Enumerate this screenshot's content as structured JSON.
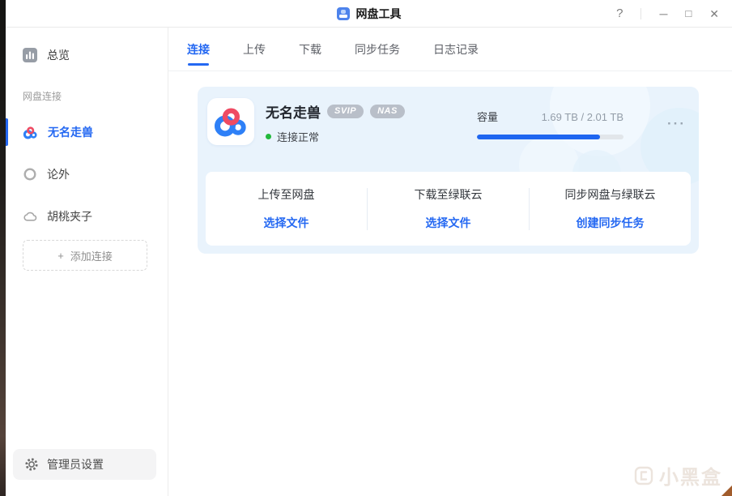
{
  "window": {
    "title": "网盘工具",
    "controls": {
      "help": "?",
      "minimize": "─",
      "maximize": "□",
      "close": "✕"
    }
  },
  "sidebar": {
    "overview_label": "总览",
    "section_label": "网盘连接",
    "connections": [
      {
        "label": "无名走兽",
        "active": true
      },
      {
        "label": "论外",
        "active": false
      },
      {
        "label": "胡桃夹子",
        "active": false
      }
    ],
    "add_icon": "+",
    "add_connection_label": "添加连接",
    "admin_settings_label": "管理员设置"
  },
  "tabs": [
    {
      "label": "连接",
      "active": true
    },
    {
      "label": "上传",
      "active": false
    },
    {
      "label": "下载",
      "active": false
    },
    {
      "label": "同步任务",
      "active": false
    },
    {
      "label": "日志记录",
      "active": false
    }
  ],
  "connection_card": {
    "name": "无名走兽",
    "badges": [
      "SVIP",
      "NAS"
    ],
    "status_text": "连接正常",
    "capacity": {
      "label": "容量",
      "used": "1.69 TB",
      "total": "2.01 TB",
      "display": "1.69 TB / 2.01 TB",
      "percent": 84
    },
    "more_icon": "···",
    "actions": [
      {
        "title": "上传至网盘",
        "button": "选择文件"
      },
      {
        "title": "下载至绿联云",
        "button": "选择文件"
      },
      {
        "title": "同步网盘与绿联云",
        "button": "创建同步任务"
      }
    ]
  },
  "watermark": {
    "text": "小黑盒"
  },
  "colors": {
    "accent": "#2468f2",
    "card_bg": "#e9f3fc",
    "progress_fill": "#1f66f0",
    "progress_track": "#e2e6ea",
    "badge_bg": "#b9bfc9",
    "status_green": "#22b93c"
  }
}
